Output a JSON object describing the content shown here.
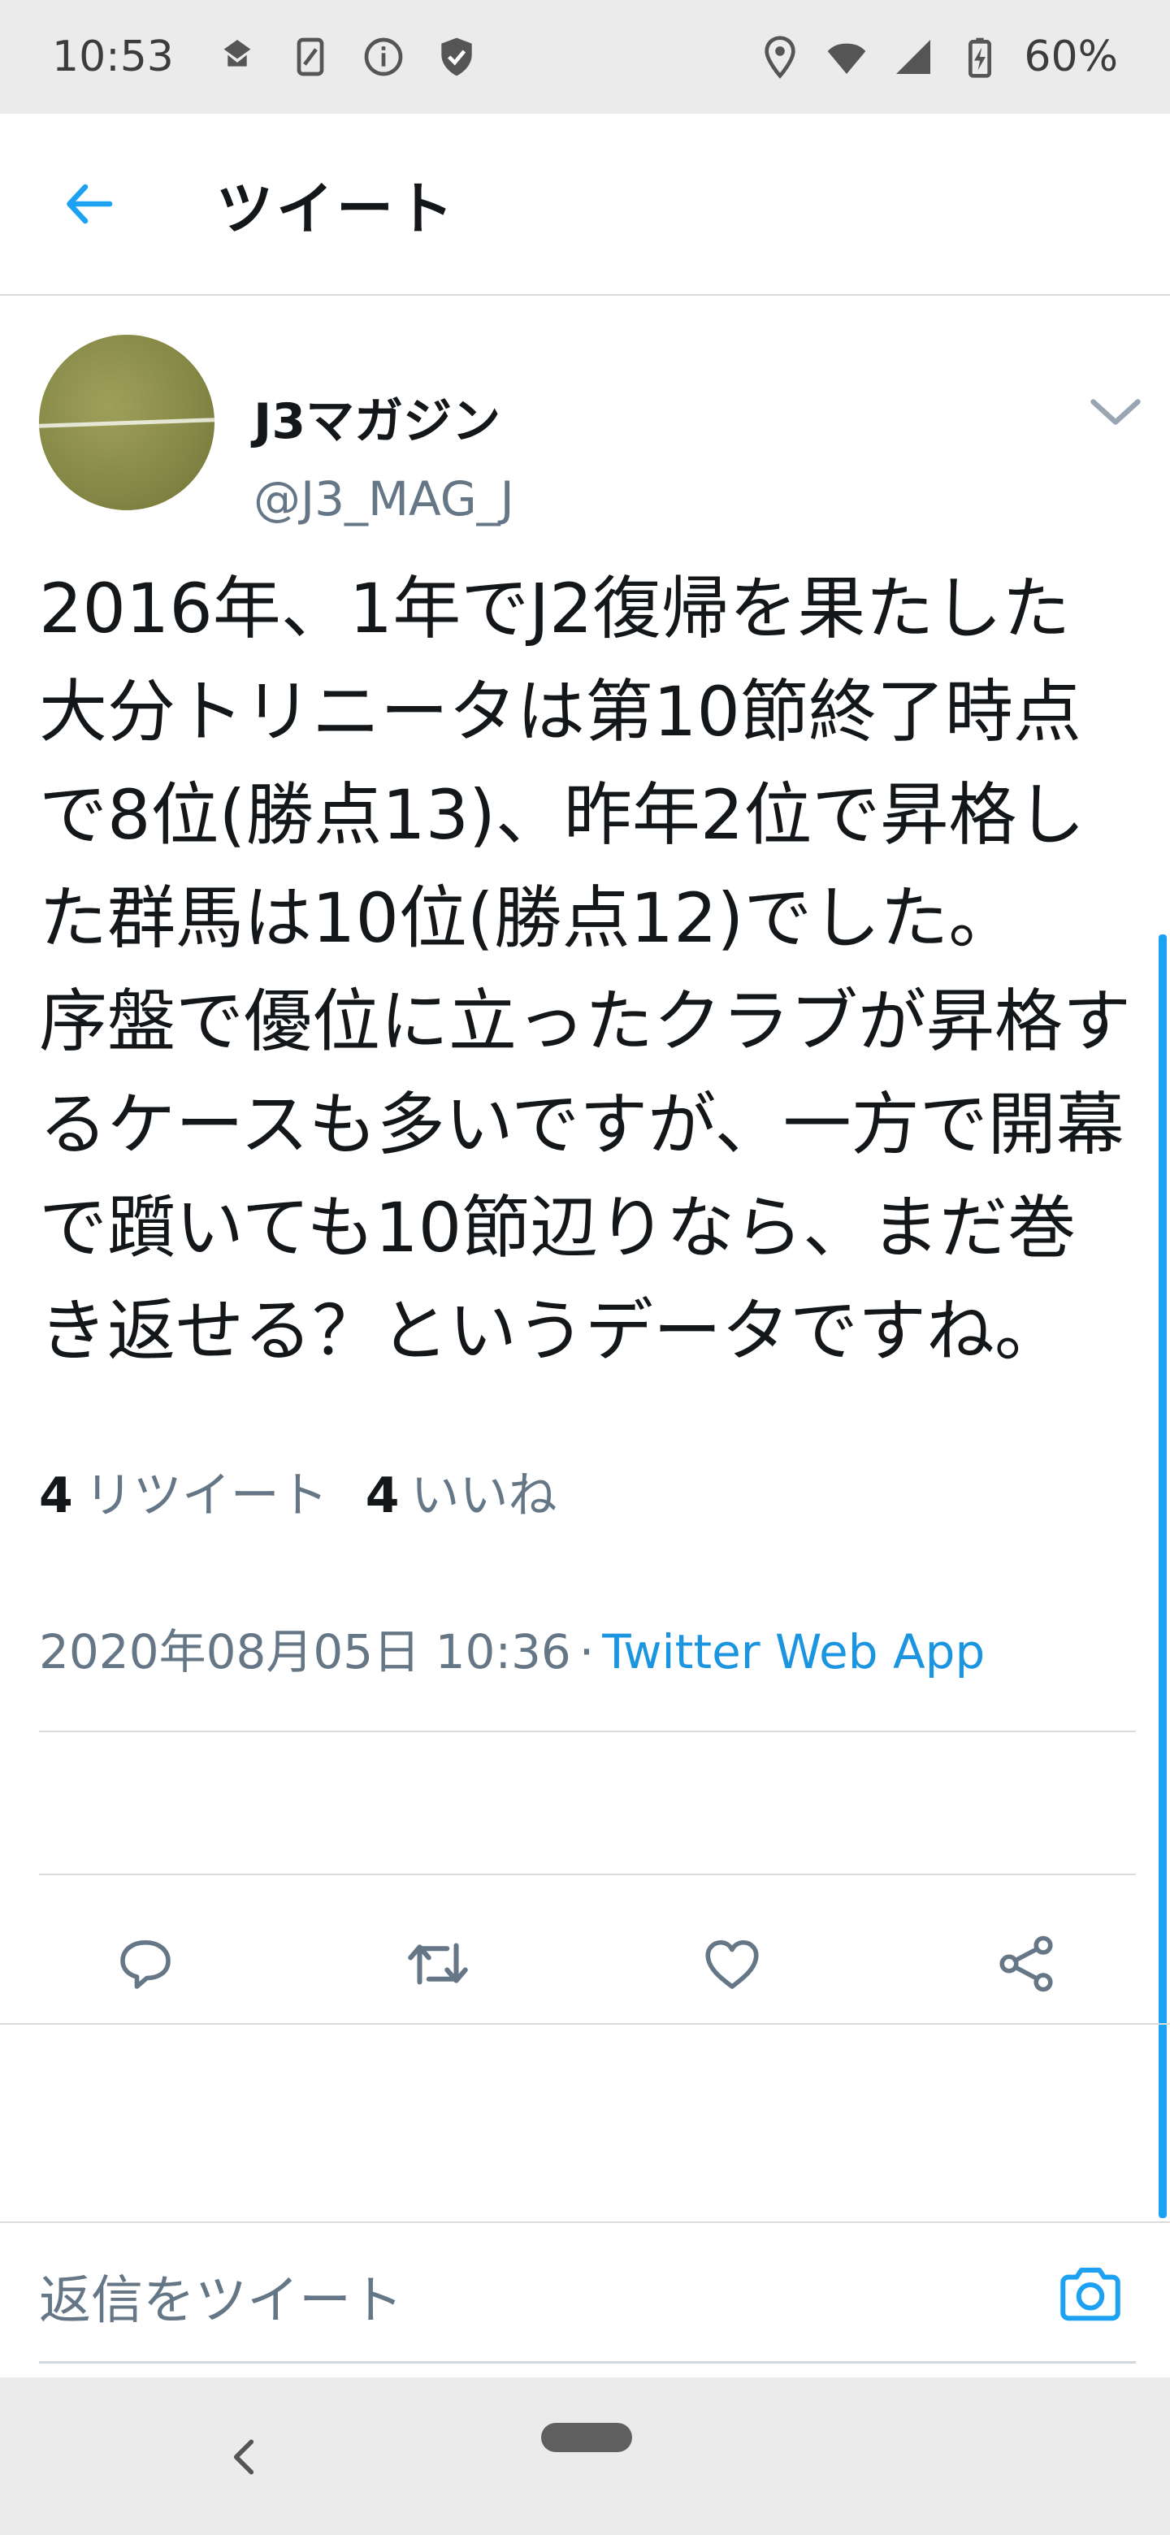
{
  "status_bar": {
    "time": "10:53",
    "battery": "60%",
    "left_icons": [
      "app-notification-icon",
      "sim-icon",
      "info-icon",
      "shield-icon"
    ],
    "right_icons": [
      "location-icon",
      "wifi-icon",
      "signal-icon",
      "battery-icon"
    ]
  },
  "header": {
    "title": "ツイート",
    "back_icon": "arrow-left-icon",
    "accent_color": "#1da1f2"
  },
  "tweet": {
    "author": {
      "display_name": "J3マガジン",
      "handle": "@J3_MAG_J"
    },
    "text": "2016年、1年でJ2復帰を果たした大分トリニータは第10節終了時点で8位(勝点13)、昨年2位で昇格した群馬は10位(勝点12)でした。\n序盤で優位に立ったクラブが昇格するケースも多いですが、一方で開幕で躓いても10節辺りなら、まだ巻き返せる？というデータですね。",
    "timestamp": "2020年08月05日 10:36",
    "separator": "·",
    "source": "Twitter Web App",
    "retweet_count": "4",
    "retweet_label": "リツイート",
    "like_count": "4",
    "like_label": "いいね",
    "actions": [
      "reply-icon",
      "retweet-icon",
      "like-icon",
      "share-icon"
    ]
  },
  "reply": {
    "placeholder": "返信をツイート",
    "camera_icon": "camera-icon"
  },
  "nav": {
    "back_icon": "chevron-left-icon",
    "home_icon": "home-pill-icon"
  }
}
